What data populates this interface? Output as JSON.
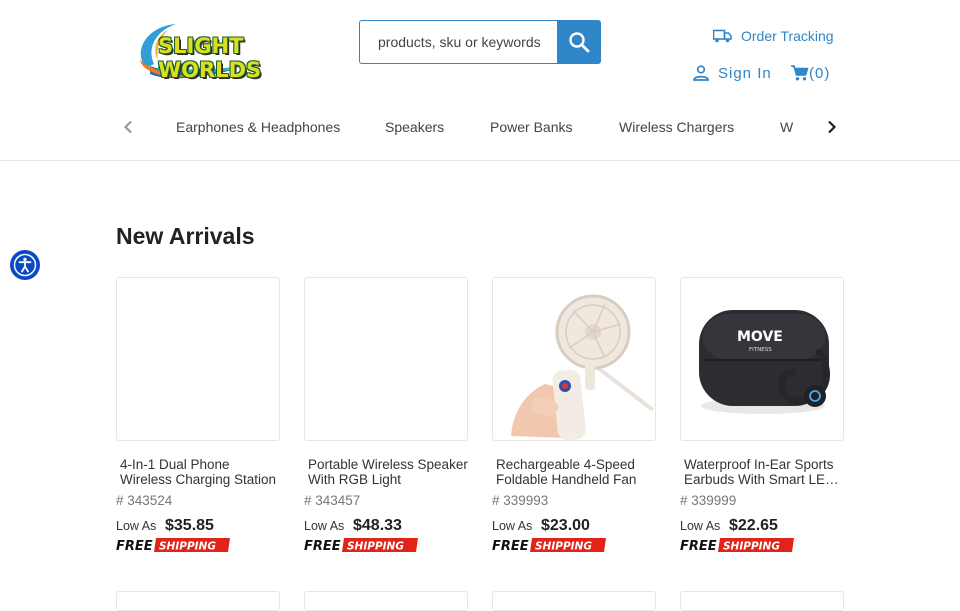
{
  "header": {
    "logo_text": "SLIGHT WORLDS",
    "search": {
      "placeholder": "products, sku or keywords",
      "value": ""
    },
    "order_tracking_label": "Order Tracking",
    "sign_in_label": "Sign In",
    "cart_label": "(0)",
    "accent_color": "#2f86c9"
  },
  "categories": [
    "Earphones & Headphones",
    "Speakers",
    "Power Banks",
    "Wireless Chargers",
    "W"
  ],
  "main": {
    "section_title": "New Arrivals",
    "products": [
      {
        "name": "4-In-1 Dual Phone Wireless Charging Station",
        "sku": "# 343524",
        "low_as": "Low As",
        "price": "$35.85",
        "badge": "FREE SHIPPING",
        "image": "blank"
      },
      {
        "name": "Portable Wireless Speaker With RGB Light",
        "sku": "# 343457",
        "low_as": "Low As",
        "price": "$48.33",
        "badge": "FREE SHIPPING",
        "image": "blank"
      },
      {
        "name": "Rechargeable 4-Speed Foldable Handheld Fan",
        "sku": "# 339993",
        "low_as": "Low As",
        "price": "$23.00",
        "badge": "FREE SHIPPING",
        "image": "handheld-fan"
      },
      {
        "name": "Waterproof In-Ear Sports Earbuds With Smart LED Display",
        "sku": "# 339999",
        "low_as": "Low As",
        "price": "$22.65",
        "badge": "FREE SHIPPING",
        "image": "earbuds-case",
        "image_text": "MOVE",
        "image_subtext": "FITNESS"
      }
    ]
  },
  "icons": {
    "search": "search-icon",
    "truck": "truck-icon",
    "user": "user-icon",
    "cart": "cart-icon",
    "prev": "chevron-left-icon",
    "next": "chevron-right-icon",
    "accessibility": "accessibility-icon"
  }
}
